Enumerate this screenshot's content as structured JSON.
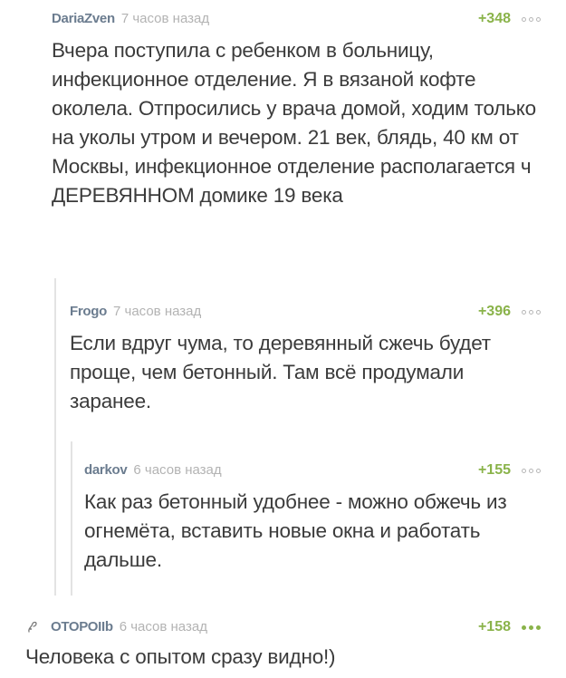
{
  "comments": [
    {
      "author": "DariaZven",
      "time": "7 часов назад",
      "rating": "+348",
      "text": "Вчера поступила с ребенком в больницу, инфекционное отделение. Я в вязаной кофте околела. Отпросились у врача домой, ходим только на уколы утром и вечером. 21 век, блядь, 40 км от Москвы, инфекционное отделение располагается ч ДЕРЕВЯННОМ домике 19 века"
    },
    {
      "author": "Frogo",
      "time": "7 часов назад",
      "rating": "+396",
      "text": "Если вдруг чума, то деревянный сжечь будет проще, чем бетонный. Там всё продумали заранее."
    },
    {
      "author": "darkov",
      "time": "6 часов назад",
      "rating": "+155",
      "text": "Как раз бетонный удобнее - можно обжечь из огнемёта, вставить новые окна и работать дальше."
    },
    {
      "author": "ОТОРОIIb",
      "time": "6 часов назад",
      "rating": "+158",
      "text": "Человека с опытом сразу видно!)"
    }
  ],
  "colors": {
    "author": "#6b7c8f",
    "time": "#b3b3b3",
    "rating": "#8ab34a",
    "thread_line": "#e3e3e3"
  },
  "icons": {
    "more": "more-dots-icon",
    "user": "user-icon"
  }
}
